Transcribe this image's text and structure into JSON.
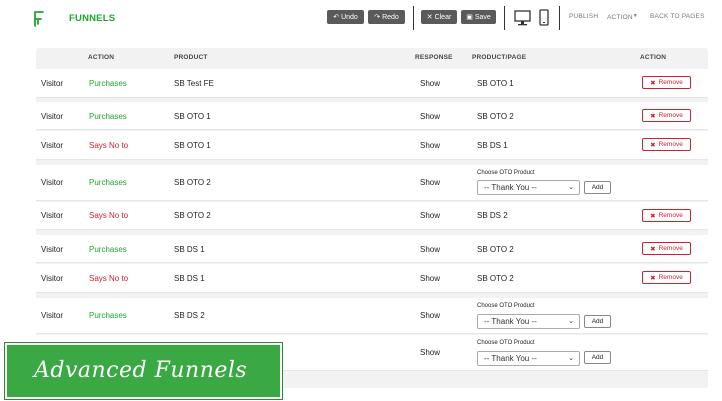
{
  "app": {
    "title": "FUNNELS",
    "brand_color": "#1fa52f"
  },
  "toolbar": {
    "undo": "Undo",
    "redo": "Redo",
    "clear": "Clear",
    "save": "Save",
    "publish": "PUBLISH",
    "action": "ACTION",
    "back": "BACK TO PAGES"
  },
  "table": {
    "headers": {
      "action": "ACTION",
      "product": "PRODUCT",
      "response": "RESPONSE",
      "product_page": "PRODUCT/PAGE",
      "action2": "ACTION"
    },
    "remove_label": "Remove",
    "oto_label": "Choose OTO Product",
    "select_value": "-- Thank You --",
    "add_label": "Add",
    "rows": [
      {
        "who": "Visitor",
        "action": "Purchases",
        "product": "SB Test FE",
        "response": "Show",
        "page": "SB OTO 1"
      },
      {
        "who": "Visitor",
        "action": "Purchases",
        "product": "SB OTO 1",
        "response": "Show",
        "page": "SB OTO 2"
      },
      {
        "who": "Visitor",
        "action": "Says No to",
        "product": "SB OTO 1",
        "response": "Show",
        "page": "SB DS 1"
      },
      {
        "who": "Visitor",
        "action": "Purchases",
        "product": "SB OTO 2",
        "response": "Show",
        "page": ""
      },
      {
        "who": "Visitor",
        "action": "Says No to",
        "product": "SB OTO 2",
        "response": "Show",
        "page": "SB DS 2"
      },
      {
        "who": "Visitor",
        "action": "Purchases",
        "product": "SB DS 1",
        "response": "Show",
        "page": "SB OTO 2"
      },
      {
        "who": "Visitor",
        "action": "Says No to",
        "product": "SB DS 1",
        "response": "Show",
        "page": "SB OTO 2"
      },
      {
        "who": "Visitor",
        "action": "Purchases",
        "product": "SB DS 2",
        "response": "Show",
        "page": ""
      },
      {
        "who": "",
        "action": "",
        "product": "",
        "response": "Show",
        "page": ""
      }
    ]
  },
  "banner": {
    "text": "Advanced Funnels"
  }
}
